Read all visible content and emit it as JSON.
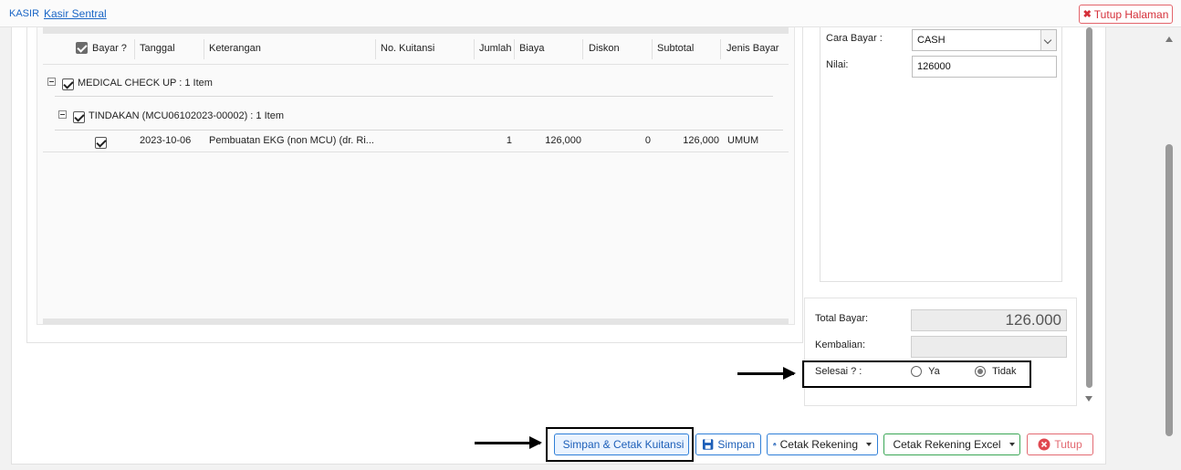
{
  "breadcrumb": {
    "module": "KASIR",
    "tab": "Kasir Sentral"
  },
  "header": {
    "close_page_label": "Tutup Halaman"
  },
  "grid": {
    "columns": [
      "Bayar ?",
      "Tanggal",
      "Keterangan",
      "No. Kuitansi",
      "Jumlah",
      "Biaya",
      "Diskon",
      "Subtotal",
      "Jenis Bayar"
    ],
    "groups": [
      {
        "label": "MEDICAL CHECK UP : 1 Item",
        "subgroups": [
          {
            "label": "TINDAKAN (MCU06102023-00002) : 1 Item",
            "rows": [
              {
                "tanggal": "2023-10-06",
                "keterangan": "Pembuatan EKG (non MCU) (dr. Ri...",
                "no_kuitansi": "",
                "jumlah": "1",
                "biaya": "126,000",
                "diskon": "0",
                "subtotal": "126,000",
                "jenis_bayar": "UMUM"
              }
            ]
          }
        ]
      }
    ]
  },
  "payment": {
    "cara_bayar_label": "Cara Bayar :",
    "cara_bayar_value": "CASH",
    "nilai_label": "Nilai:",
    "nilai_value": "126000",
    "total_bayar_label": "Total Bayar:",
    "total_bayar_value": "126.000",
    "kembalian_label": "Kembalian:",
    "kembalian_value": "",
    "selesai_label": "Selesai ? :",
    "selesai_options": [
      "Ya",
      "Tidak"
    ],
    "selesai_selected": "Tidak"
  },
  "buttons": {
    "simpan_cetak": "Simpan & Cetak Kuitansi",
    "simpan": "Simpan",
    "cetak_rekening": "Cetak Rekening",
    "cetak_rekening_excel": "Cetak Rekening Excel",
    "tutup": "Tutup"
  },
  "colors": {
    "link": "#1a66c6",
    "danger": "#d5303a",
    "primary_border": "#2f7fd8",
    "excel_green": "#3aa655"
  }
}
